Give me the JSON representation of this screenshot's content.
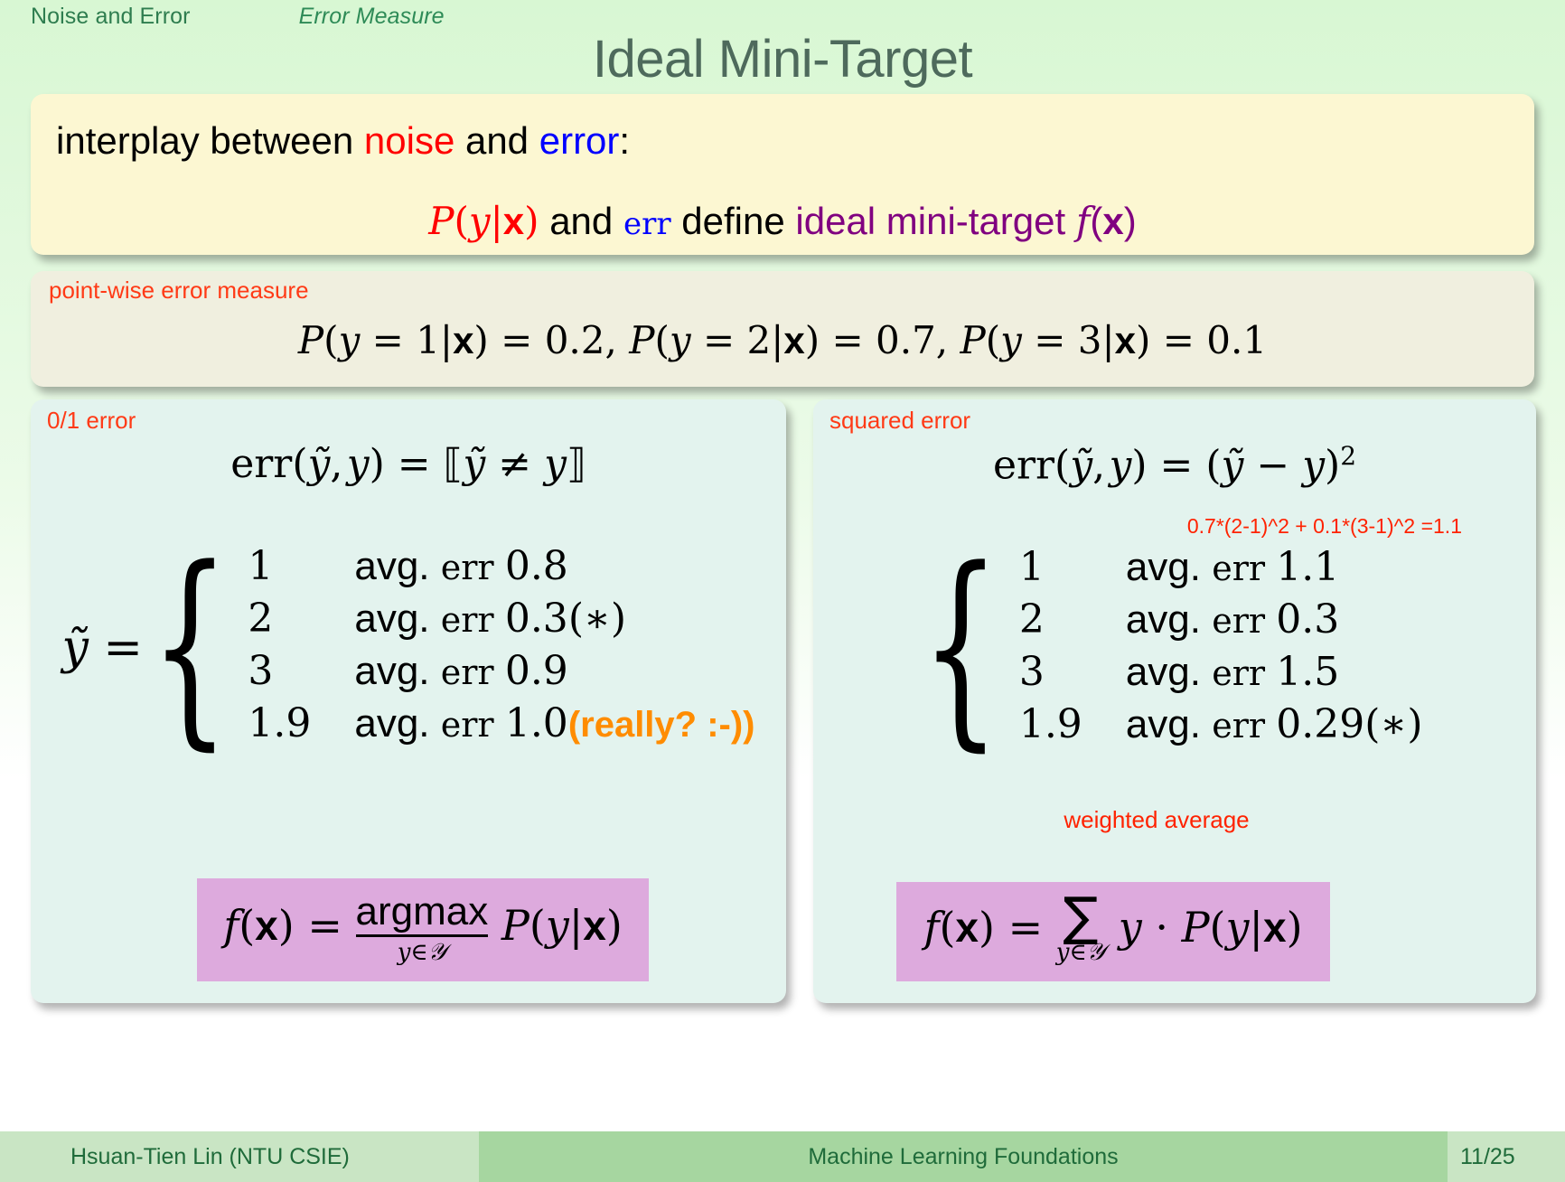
{
  "header": {
    "section": "Noise and Error",
    "subsection": "Error Measure",
    "title": "Ideal Mini-Target"
  },
  "intro_block": {
    "line1_prefix": "interplay between ",
    "line1_noise": "noise",
    "line1_and": " and ",
    "line1_error": "error",
    "line1_colon": ":",
    "line2_p": "P(y|x)",
    "line2_and": " and ",
    "line2_err": "err",
    "line2_define": " define ",
    "line2_target": "ideal mini-target f(x)"
  },
  "pointwise_block": {
    "title": "point-wise error measure",
    "formula": "P(y = 1|x) = 0.2, P(y = 2|x) = 0.7, P(y = 3|x) = 0.1",
    "probabilities": [
      {
        "y": "1",
        "p": "0.2"
      },
      {
        "y": "2",
        "p": "0.7"
      },
      {
        "y": "3",
        "p": "0.1"
      }
    ]
  },
  "left_block": {
    "title": "0/1 error",
    "formula": "err(ỹ, y) = ⟦ỹ ≠ y⟧",
    "lhs": "ỹ =",
    "cases": [
      {
        "value": "1",
        "label": "avg.",
        "errword": "err",
        "errval": "0.8",
        "mark": "",
        "note": ""
      },
      {
        "value": "2",
        "label": "avg.",
        "errword": "err",
        "errval": "0.3",
        "mark": "(∗)",
        "note": ""
      },
      {
        "value": "3",
        "label": "avg.",
        "errword": "err",
        "errval": "0.9",
        "mark": "",
        "note": ""
      },
      {
        "value": "1.9",
        "label": "avg.",
        "errword": "err",
        "errval": "1.0",
        "mark": "",
        "note": "(really? :-))"
      }
    ],
    "target_formula": {
      "lhs": "f(x) =",
      "op_top": "argmax",
      "op_bottom": "y∈𝒴",
      "rhs": "P(y|x)"
    }
  },
  "right_block": {
    "title": "squared error",
    "formula_lhs": "err(ỹ, y) = (ỹ − y)",
    "formula_exp": "2",
    "annotation": "0.7*(2-1)^2 + 0.1*(3-1)^2 =1.1",
    "cases": [
      {
        "value": "1",
        "label": "avg.",
        "errword": "err",
        "errval": "1.1",
        "mark": ""
      },
      {
        "value": "2",
        "label": "avg.",
        "errword": "err",
        "errval": "0.3",
        "mark": ""
      },
      {
        "value": "3",
        "label": "avg.",
        "errword": "err",
        "errval": "1.5",
        "mark": ""
      },
      {
        "value": "1.9",
        "label": "avg.",
        "errword": "err",
        "errval": "0.29",
        "mark": "(∗)"
      }
    ],
    "weighted_note": "weighted average",
    "target_formula": {
      "lhs": "f(x) =",
      "sum": "∑",
      "sum_sub": "y∈𝒴",
      "rhs": "y · P(y|x)"
    }
  },
  "footer": {
    "author": "Hsuan-Tien Lin  (NTU CSIE)",
    "course": "Machine Learning Foundations",
    "page": "11/25"
  },
  "colors": {
    "noise": "#ff0000",
    "error": "#0000ff",
    "target": "#800080",
    "alert": "#ff3a16",
    "joke": "#ff8c00",
    "highlight": "#ddaadd",
    "title": "#4e6a5c"
  }
}
